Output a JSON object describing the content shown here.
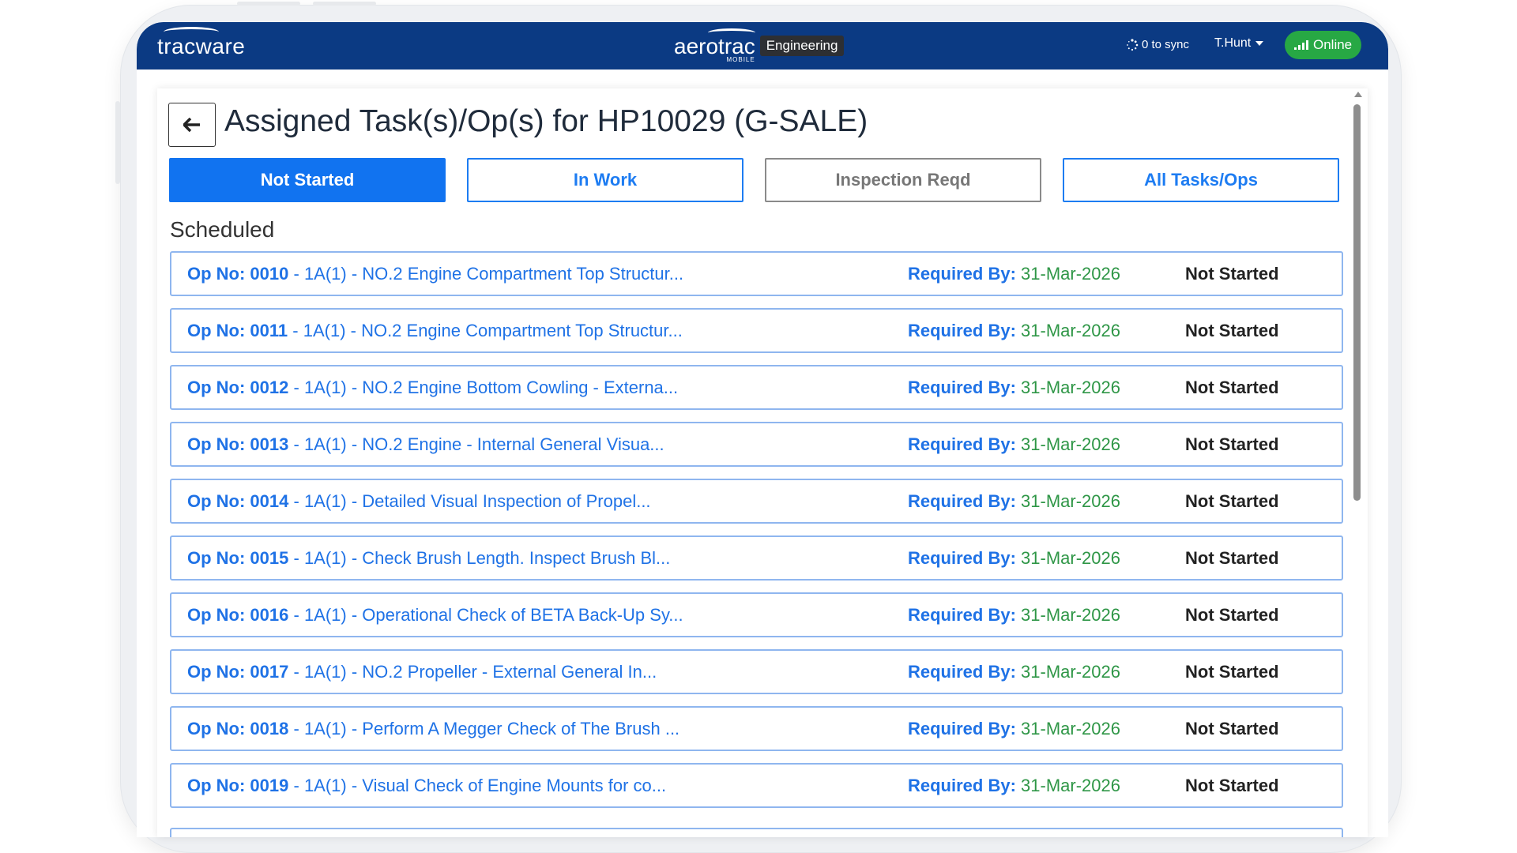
{
  "app": {
    "left_brand": "tracware",
    "center_brand": "aerotrac",
    "center_brand_sub": "MOBILE",
    "module_badge": "Engineering",
    "sync_text": "0 to sync",
    "user": "T.Hunt",
    "connection_status": "Online",
    "colors": {
      "topbar": "#0b3a83",
      "accent": "#1173f0",
      "online": "#27a844",
      "date": "#2e9646"
    }
  },
  "page": {
    "title": "Assigned Task(s)/Op(s) for HP10029 (G-SALE)",
    "back_icon": "arrow-left-icon"
  },
  "tabs": [
    {
      "label": "Not Started",
      "active": true
    },
    {
      "label": "In Work",
      "active": false
    },
    {
      "label": "Inspection Reqd",
      "active": false
    },
    {
      "label": "All Tasks/Ops",
      "active": false
    }
  ],
  "section_title": "Scheduled",
  "required_label": "Required By:",
  "operations": [
    {
      "op_label": "Op No: 0010",
      "description": "- 1A(1) - NO.2 Engine Compartment Top Structur...",
      "required_by": "31-Mar-2026",
      "status": "Not Started"
    },
    {
      "op_label": "Op No: 0011",
      "description": "- 1A(1) - NO.2 Engine Compartment Top Structur...",
      "required_by": "31-Mar-2026",
      "status": "Not Started"
    },
    {
      "op_label": "Op No: 0012",
      "description": "- 1A(1) - NO.2 Engine Bottom Cowling - Externa...",
      "required_by": "31-Mar-2026",
      "status": "Not Started"
    },
    {
      "op_label": "Op No: 0013",
      "description": "- 1A(1) - NO.2 Engine - Internal General Visua...",
      "required_by": "31-Mar-2026",
      "status": "Not Started"
    },
    {
      "op_label": "Op No: 0014",
      "description": "- 1A(1) - Detailed Visual Inspection of Propel...",
      "required_by": "31-Mar-2026",
      "status": "Not Started"
    },
    {
      "op_label": "Op No: 0015",
      "description": "- 1A(1) - Check Brush Length. Inspect Brush Bl...",
      "required_by": "31-Mar-2026",
      "status": "Not Started"
    },
    {
      "op_label": "Op No: 0016",
      "description": "- 1A(1) - Operational Check of BETA Back-Up Sy...",
      "required_by": "31-Mar-2026",
      "status": "Not Started"
    },
    {
      "op_label": "Op No: 0017",
      "description": "- 1A(1) - NO.2 Propeller - External General In...",
      "required_by": "31-Mar-2026",
      "status": "Not Started"
    },
    {
      "op_label": "Op No: 0018",
      "description": "- 1A(1) - Perform A Megger Check of The Brush ...",
      "required_by": "31-Mar-2026",
      "status": "Not Started"
    },
    {
      "op_label": "Op No: 0019",
      "description": "- 1A(1) - Visual Check of Engine Mounts for co...",
      "required_by": "31-Mar-2026",
      "status": "Not Started"
    }
  ]
}
